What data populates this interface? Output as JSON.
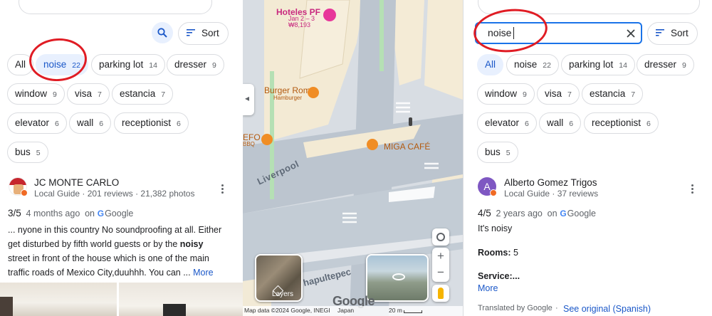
{
  "left": {
    "filters": [
      {
        "label": "All",
        "count": ""
      },
      {
        "label": "noise",
        "count": "22"
      },
      {
        "label": "parking lot",
        "count": "14"
      },
      {
        "label": "dresser",
        "count": "9"
      },
      {
        "label": "window",
        "count": "9"
      },
      {
        "label": "visa",
        "count": "7"
      },
      {
        "label": "estancia",
        "count": "7"
      },
      {
        "label": "elevator",
        "count": "6"
      },
      {
        "label": "wall",
        "count": "6"
      },
      {
        "label": "receptionist",
        "count": "6"
      },
      {
        "label": "bus",
        "count": "5"
      }
    ],
    "sort_label": "Sort",
    "review": {
      "author": "JC MONTE CARLO",
      "meta": "Local Guide · 201 reviews · 21,382 photos",
      "rating": "3/5",
      "ago": "4 months ago",
      "on": "on",
      "source": "Google",
      "text_1": "... nyone in this country No soundproofing at all. Either",
      "text_2a": "get disturbed by fifth world guests or by the ",
      "text_2b": "noisy",
      "text_3": "street in front of the house which is one of the main",
      "text_4": "traffic roads of Mexico City,duuhhh. You can  ... ",
      "more": "More"
    }
  },
  "map": {
    "hotel_name": "Hoteles PF",
    "hotel_dates": "Jan 2 – 3",
    "hotel_price": "₩8,193",
    "restaurant_1": "Burger Roma",
    "restaurant_1_sub": "Hamburger",
    "restaurant_2": "EFO",
    "restaurant_2_sub": "BBQ",
    "cafe": "MIGA CAFÉ",
    "street_1": "Liverpool",
    "street_2": "hapultepec",
    "layers_label": "Layers",
    "brand": "Google",
    "attribution": "Map data ©2024 Google, INEGI",
    "region": "Japan",
    "scale": "20 m"
  },
  "right": {
    "search_value": "noise",
    "sort_label": "Sort",
    "filters": [
      {
        "label": "All",
        "count": ""
      },
      {
        "label": "noise",
        "count": "22"
      },
      {
        "label": "parking lot",
        "count": "14"
      },
      {
        "label": "dresser",
        "count": "9"
      },
      {
        "label": "window",
        "count": "9"
      },
      {
        "label": "visa",
        "count": "7"
      },
      {
        "label": "estancia",
        "count": "7"
      },
      {
        "label": "elevator",
        "count": "6"
      },
      {
        "label": "wall",
        "count": "6"
      },
      {
        "label": "receptionist",
        "count": "6"
      },
      {
        "label": "bus",
        "count": "5"
      }
    ],
    "review": {
      "avatar_letter": "A",
      "author": "Alberto Gomez Trigos",
      "meta": "Local Guide · 37 reviews",
      "rating": "4/5",
      "ago": "2 years ago",
      "on": "on",
      "source": "Google",
      "text": "It's noisy",
      "rooms_label": "Rooms:",
      "rooms_value": " 5",
      "service_label": "Service:...",
      "more": "More",
      "translated": "Translated by Google",
      "dot": "·",
      "see_original": "See original (Spanish)"
    }
  },
  "colors": {
    "accent": "#1a57c8",
    "annotation_red": "#e01c24",
    "selected_chip_bg": "#e8f0fe"
  }
}
